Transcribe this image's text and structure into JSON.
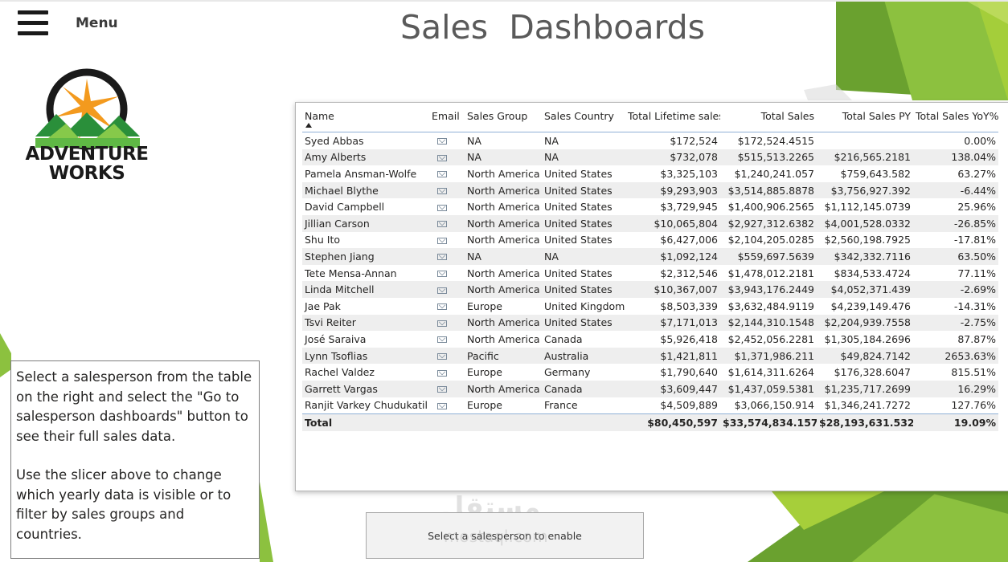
{
  "header": {
    "menu_label": "Menu",
    "title": "Sales  Dashboards"
  },
  "logo": {
    "name": "ADVENTURE WORKS",
    "line1": "ADVENTURE",
    "line2": "WORKS"
  },
  "table": {
    "columns": [
      "Name",
      "Email",
      "Sales Group",
      "Sales Country",
      "Total Lifetime sales",
      "Total Sales",
      "Total Sales PY",
      "Total Sales YoY%"
    ],
    "rows": [
      [
        "Syed Abbas",
        "",
        "NA",
        "NA",
        "$172,524",
        "$172,524.4515",
        "",
        "0.00%"
      ],
      [
        "Amy Alberts",
        "",
        "NA",
        "NA",
        "$732,078",
        "$515,513.2265",
        "$216,565.2181",
        "138.04%"
      ],
      [
        "Pamela Ansman-Wolfe",
        "",
        "North America",
        "United States",
        "$3,325,103",
        "$1,240,241.057",
        "$759,643.582",
        "63.27%"
      ],
      [
        "Michael Blythe",
        "",
        "North America",
        "United States",
        "$9,293,903",
        "$3,514,885.8878",
        "$3,756,927.392",
        "-6.44%"
      ],
      [
        "David Campbell",
        "",
        "North America",
        "United States",
        "$3,729,945",
        "$1,400,906.2565",
        "$1,112,145.0739",
        "25.96%"
      ],
      [
        "Jillian Carson",
        "",
        "North America",
        "United States",
        "$10,065,804",
        "$2,927,312.6382",
        "$4,001,528.0332",
        "-26.85%"
      ],
      [
        "Shu Ito",
        "",
        "North America",
        "United States",
        "$6,427,006",
        "$2,104,205.0285",
        "$2,560,198.7925",
        "-17.81%"
      ],
      [
        "Stephen Jiang",
        "",
        "NA",
        "NA",
        "$1,092,124",
        "$559,697.5639",
        "$342,332.7116",
        "63.50%"
      ],
      [
        "Tete Mensa-Annan",
        "",
        "North America",
        "United States",
        "$2,312,546",
        "$1,478,012.2181",
        "$834,533.4724",
        "77.11%"
      ],
      [
        "Linda Mitchell",
        "",
        "North America",
        "United States",
        "$10,367,007",
        "$3,943,176.2449",
        "$4,052,371.439",
        "-2.69%"
      ],
      [
        "Jae Pak",
        "",
        "Europe",
        "United Kingdom",
        "$8,503,339",
        "$3,632,484.9119",
        "$4,239,149.476",
        "-14.31%"
      ],
      [
        "Tsvi Reiter",
        "",
        "North America",
        "United States",
        "$7,171,013",
        "$2,144,310.1548",
        "$2,204,939.7558",
        "-2.75%"
      ],
      [
        "José Saraiva",
        "",
        "North America",
        "Canada",
        "$5,926,418",
        "$2,452,056.2281",
        "$1,305,184.2696",
        "87.87%"
      ],
      [
        "Lynn Tsoflias",
        "",
        "Pacific",
        "Australia",
        "$1,421,811",
        "$1,371,986.211",
        "$49,824.7142",
        "2653.63%"
      ],
      [
        "Rachel Valdez",
        "",
        "Europe",
        "Germany",
        "$1,790,640",
        "$1,614,311.6264",
        "$176,328.6047",
        "815.51%"
      ],
      [
        "Garrett Vargas",
        "",
        "North America",
        "Canada",
        "$3,609,447",
        "$1,437,059.5381",
        "$1,235,717.2699",
        "16.29%"
      ],
      [
        "Ranjit Varkey Chudukatil",
        "",
        "Europe",
        "France",
        "$4,509,889",
        "$3,066,150.914",
        "$1,346,241.7272",
        "127.76%"
      ]
    ],
    "total": [
      "Total",
      "",
      "",
      "",
      "$80,450,597",
      "$33,574,834.1572",
      "$28,193,631.5321",
      "19.09%"
    ]
  },
  "info": {
    "paragraph1": "Select a salesperson from the table on the right and select the \"Go to salesperson dashboards\" button to see their full sales data.",
    "paragraph2": "Use the slicer above to change which yearly data is visible or to filter by sales groups and countries."
  },
  "button": {
    "label": "Select a salesperson to enable"
  },
  "watermark": {
    "text": "مستقل",
    "sub": "mostaql.com"
  },
  "colors": {
    "green_dark": "#6aa12f",
    "green_light": "#a6cf3a",
    "green_mid": "#8cc13f",
    "header_line": "#8fb0d6",
    "row_alt": "#eeeeee"
  },
  "icons": {
    "menu": "hamburger-menu-icon",
    "email": "email-icon",
    "sort": "sort-ascending-icon"
  }
}
